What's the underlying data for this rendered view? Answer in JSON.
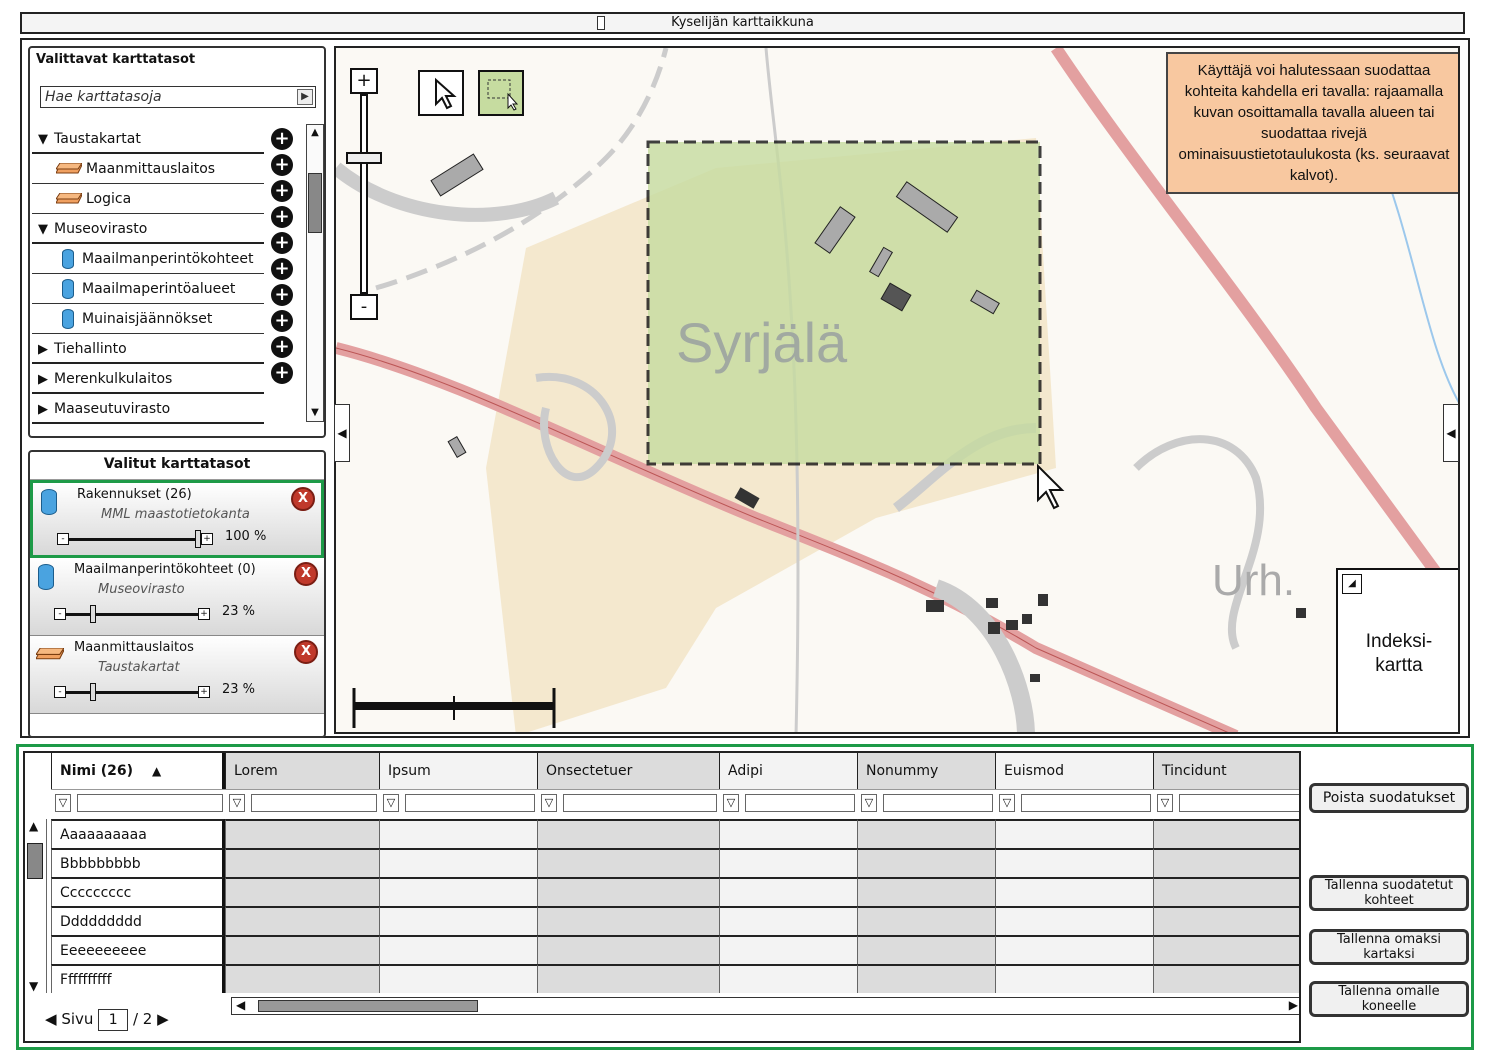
{
  "window": {
    "title": "Kyselijän karttaikkuna"
  },
  "available": {
    "title": "Valittavat karttatasot",
    "search_placeholder": "Hae karttatasoja",
    "tree": [
      {
        "label": "Taustakartat",
        "kind": "group-open"
      },
      {
        "label": "Maanmittauslaitos",
        "kind": "layer"
      },
      {
        "label": "Logica",
        "kind": "layer"
      },
      {
        "label": "Museovirasto",
        "kind": "group-open"
      },
      {
        "label": "Maailmanperintökohteet",
        "kind": "db"
      },
      {
        "label": "Maailmaperintöalueet",
        "kind": "db"
      },
      {
        "label": "Muinaisjäännökset",
        "kind": "db"
      },
      {
        "label": "Tiehallinto",
        "kind": "group-closed"
      },
      {
        "label": "Merenkulkulaitos",
        "kind": "group-closed"
      },
      {
        "label": "Maaseutuvirasto",
        "kind": "group-closed"
      }
    ]
  },
  "selected": {
    "title": "Valitut karttatasot",
    "items": [
      {
        "name": "Rakennukset  (26)",
        "source": "MML maastotietokanta",
        "opacity": "100 %",
        "opacity_value": 1.0,
        "icon": "db"
      },
      {
        "name": "Maailmanperintökohteet  (0)",
        "source": "Museovirasto",
        "opacity": "23 %",
        "opacity_value": 0.23,
        "icon": "db"
      },
      {
        "name": "Maanmittauslaitos",
        "source": "Taustakartat",
        "opacity": "23 %",
        "opacity_value": 0.23,
        "icon": "layer"
      }
    ]
  },
  "map": {
    "place_label": "Syrjälä",
    "place_label_2": "Urh.",
    "note": "Käyttäjä voi halutessaan suodattaa kohteita kahdella eri tavalla: rajaamalla kuvan osoittamalla tavalla alueen tai suodattaa rivejä ominaisuustietotaulukosta (ks. seuraavat kalvot).",
    "index_map": "Indeksi-\nkartta",
    "zoom_in": "+",
    "zoom_out": "-"
  },
  "grid": {
    "name_header": "Nimi (26)",
    "columns": [
      "Lorem",
      "Ipsum",
      "Onsectetuer",
      "Adipi",
      "Nonummy",
      "Euismod",
      "Tincidunt"
    ],
    "rows": [
      "Aaaaaaaaaa",
      "Bbbbbbbbb",
      "Ccccccccc",
      "Ddddddddd",
      "Eeeeeeeeee",
      "Ffffffffff"
    ],
    "pager": {
      "label": "Sivu",
      "page": "1",
      "total": "/ 2"
    },
    "buttons": {
      "clear_filters": "Poista suodatukset",
      "save_filtered": "Tallenna suodatetut kohteet",
      "save_as_map": "Tallenna omaksi kartaksi",
      "save_to_computer": "Tallenna omalle koneelle"
    }
  },
  "colors": {
    "accent_green": "#1d9a47",
    "note_bg": "#f8c8a0",
    "selection_fill": "#c6dca0",
    "remove_red": "#c0392b"
  }
}
